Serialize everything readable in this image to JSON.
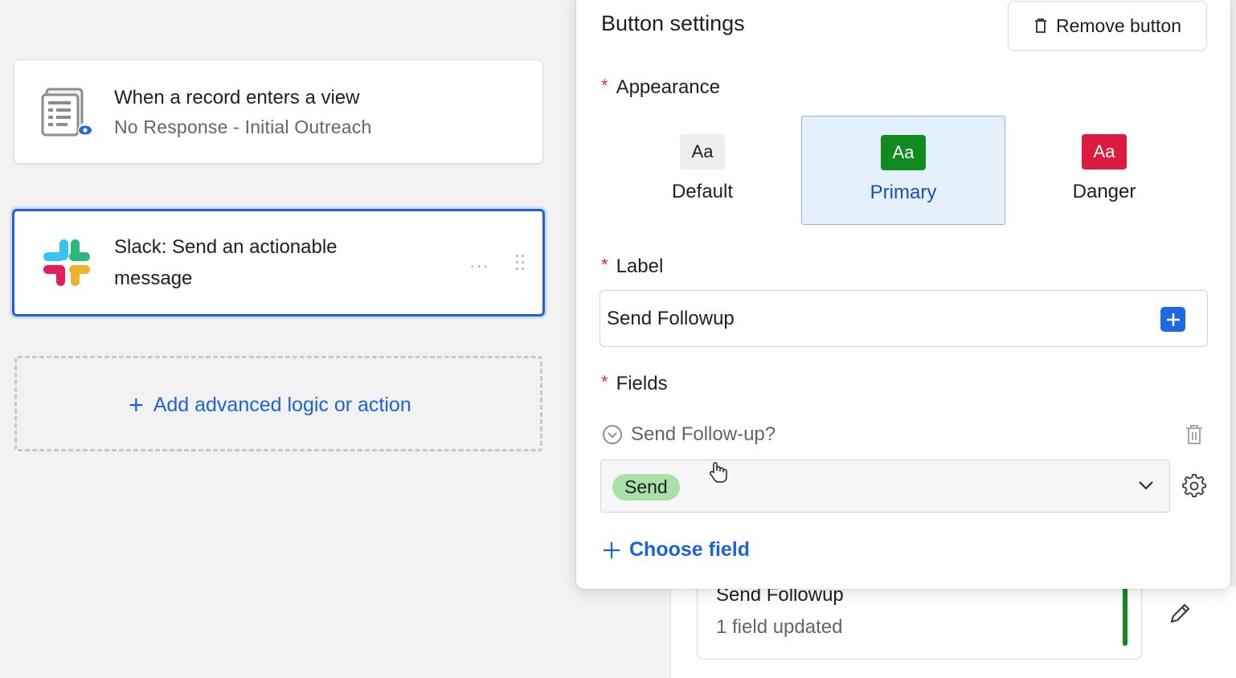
{
  "workflow": {
    "trigger": {
      "icon": "view-record-icon",
      "title": "When a record enters a view",
      "subtitle": "No Response - Initial Outreach"
    },
    "action": {
      "icon": "slack-logo",
      "title_line1": "Slack: Send an actionable",
      "title_line2": "message",
      "more_label": "···"
    },
    "add_action_label": "Add advanced logic or action"
  },
  "button_settings": {
    "title": "Button settings",
    "remove_label": "Remove button",
    "appearance": {
      "label": "Appearance",
      "options": [
        {
          "name": "Default",
          "swatch": "Aa",
          "color": "#eeeeee",
          "selected": false
        },
        {
          "name": "Primary",
          "swatch": "Aa",
          "color": "#118a1f",
          "selected": true
        },
        {
          "name": "Danger",
          "swatch": "Aa",
          "color": "#dc1c3c",
          "selected": false
        }
      ]
    },
    "label": {
      "label": "Label",
      "value": "Send Followup"
    },
    "fields": {
      "label": "Fields",
      "field_name": "Send Follow-up?",
      "selected_value": "Send",
      "choose_label": "Choose field"
    }
  },
  "background_card": {
    "title": "Send Followup",
    "subtitle": "1 field updated"
  },
  "required_marker": "*",
  "colors": {
    "accent": "#1c63d6",
    "selected_bg": "#e5f0fd",
    "success": "#13891f",
    "pill": "#a9e0a8"
  }
}
